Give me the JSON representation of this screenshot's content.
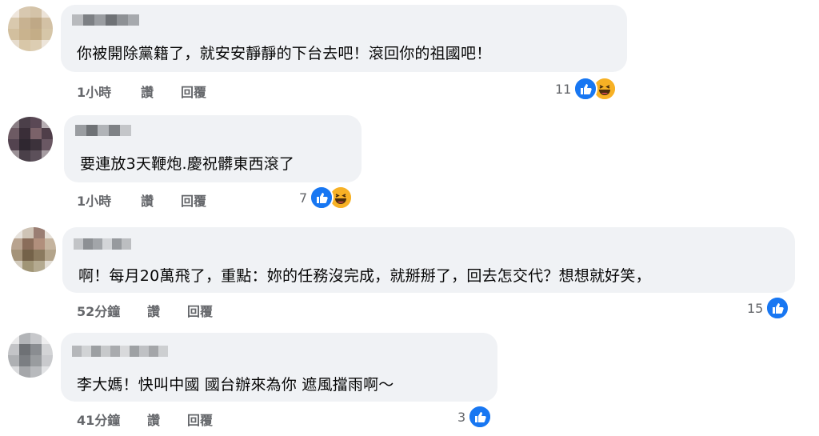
{
  "comments": [
    {
      "text": "你被開除黨籍了，就安安靜靜的下台去吧！滾回你的祖國吧！",
      "time": "1小時",
      "like_label": "讚",
      "reply_label": "回覆",
      "reaction_count": "11",
      "reactions": [
        "like-icon",
        "haha-icon"
      ]
    },
    {
      "text": "要連放3天鞭炮.慶祝髒東西滾了",
      "time": "1小時",
      "like_label": "讚",
      "reply_label": "回覆",
      "reaction_count": "7",
      "reactions": [
        "like-icon",
        "haha-icon"
      ]
    },
    {
      "text": "啊！每月20萬飛了，重點：妳的任務沒完成，就掰掰了，回去怎交代？想想就好笑，",
      "time": "52分鐘",
      "like_label": "讚",
      "reply_label": "回覆",
      "reaction_count": "15",
      "reactions": [
        "like-icon"
      ]
    },
    {
      "text": "李大媽！快叫中國 國台辦來為你 遮風擋雨啊～",
      "time": "41分鐘",
      "like_label": "讚",
      "reply_label": "回覆",
      "reaction_count": "3",
      "reactions": [
        "like-icon"
      ]
    }
  ],
  "colors": {
    "bubble": "#f0f2f5",
    "like_blue": "#1877f2",
    "haha_yellow": "#f7b125",
    "meta_gray": "#65676b"
  }
}
